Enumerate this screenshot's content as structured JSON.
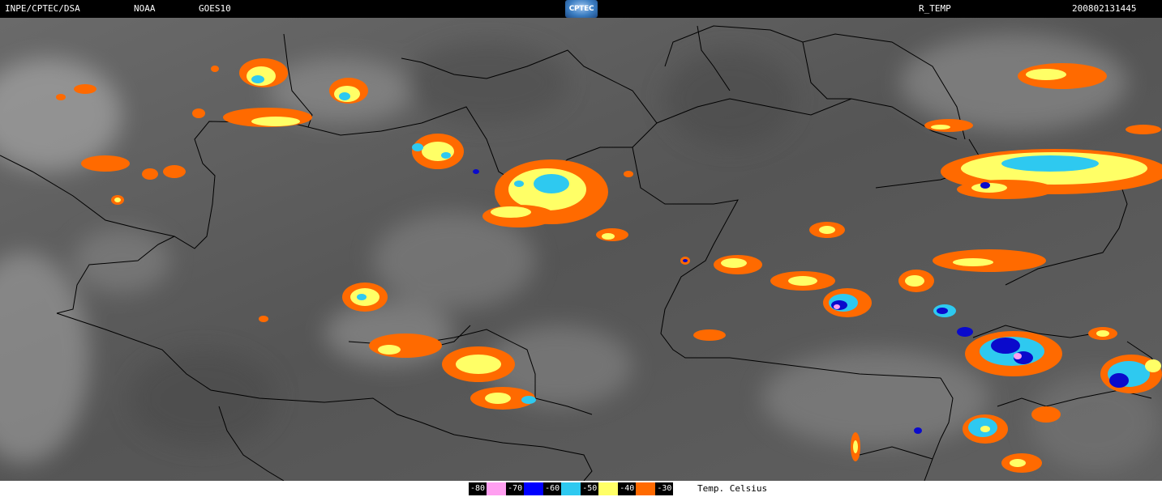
{
  "header": {
    "source": "INPE/CPTEC/DSA",
    "agency": "NOAA",
    "satellite": "GOES10",
    "logo_text": "CPTEC",
    "product": "R_TEMP",
    "timestamp": "200802131445"
  },
  "legend": {
    "entries": [
      {
        "label": "-80",
        "color": "#ff9ff0"
      },
      {
        "label": "-70",
        "color": "#0000ff"
      },
      {
        "label": "-60",
        "color": "#2ec9f0"
      },
      {
        "label": "-50",
        "color": "#ffff66"
      },
      {
        "label": "-40",
        "color": "#ff6a00"
      },
      {
        "label": "-30",
        "color": "#ff6a00"
      }
    ],
    "unit": "Temp. Celsius"
  },
  "colors": {
    "orange": "#ff6a00",
    "yellow": "#ffff66",
    "cyan": "#2ec9f0",
    "blue": "#0a0acc",
    "pink": "#ff9ff0",
    "background": "#5a5a5a",
    "border": "#000000"
  }
}
